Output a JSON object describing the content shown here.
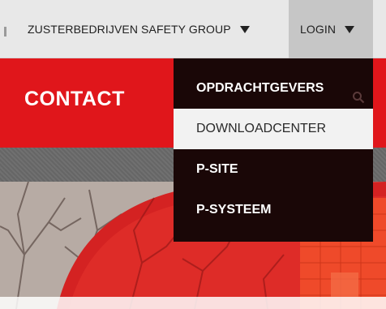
{
  "nav": {
    "sister_companies_label": "ZUSTERBEDRIJVEN SAFETY GROUP",
    "login_label": "LOGIN"
  },
  "header": {
    "title": "CONTACT"
  },
  "dropdown": {
    "items": [
      {
        "label": "OPDRACHTGEVERS",
        "active": false
      },
      {
        "label": "DOWNLOADCENTER",
        "active": true
      },
      {
        "label": "P-SITE",
        "active": false
      },
      {
        "label": "P-SYSTEEM",
        "active": false
      }
    ]
  },
  "icons": {
    "search": "search-icon",
    "caret": "caret-down-icon"
  },
  "colors": {
    "brand_red": "#e0161b",
    "dropdown_bg": "#1a0707",
    "active_item_bg": "#f2f2f2",
    "topbar_bg": "#e8e8e8",
    "login_bg": "#c6c6c6"
  }
}
